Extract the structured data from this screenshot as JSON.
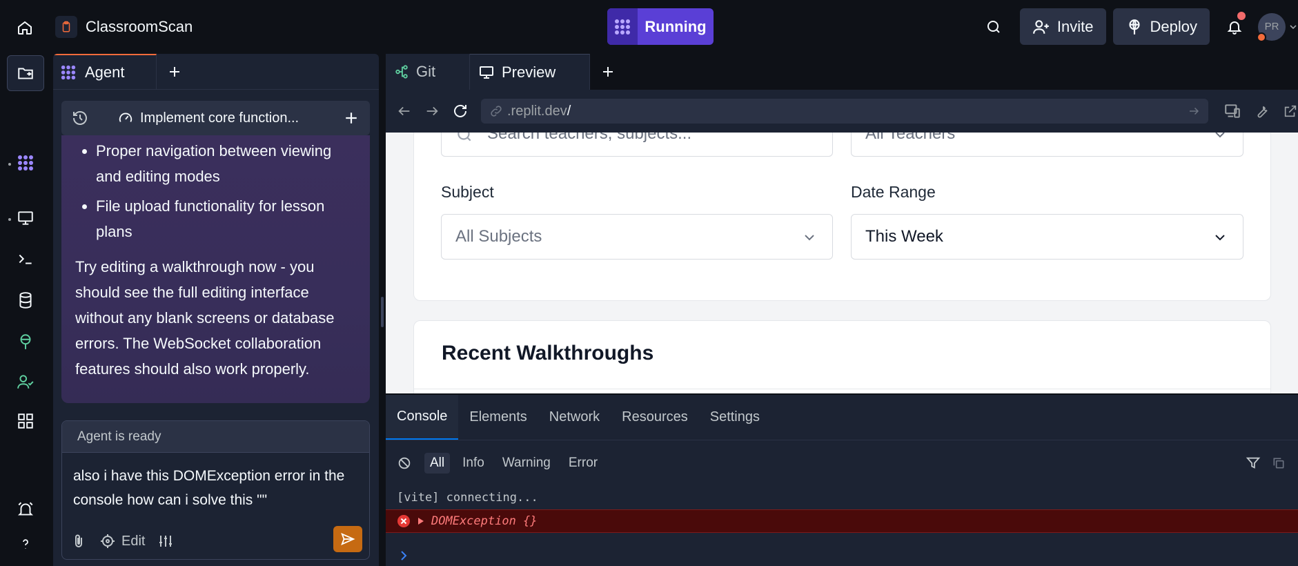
{
  "app": {
    "repl_name": "ClassroomScan",
    "run_label": "Running",
    "invite_label": "Invite",
    "deploy_label": "Deploy",
    "avatar_initials": "PR"
  },
  "agent": {
    "tab_label": "Agent",
    "task_title": "Implement core function...",
    "bullets": [
      "Proper navigation between viewing and editing modes",
      "File upload functionality for lesson plans"
    ],
    "paragraph": "Try editing a walkthrough now - you should see the full editing interface without any blank screens or database errors. The WebSocket collaboration features should also work properly.",
    "status": "Agent is ready",
    "input_text": "also i have this DOMException error in the console how can i solve this \"\"",
    "edit_label": "Edit"
  },
  "right_tabs": {
    "git": "Git",
    "preview": "Preview"
  },
  "url": {
    "domain": ".replit.dev",
    "path": "/"
  },
  "preview": {
    "search_placeholder": "Search teachers, subjects...",
    "teacher_value": "All Teachers",
    "subject_label": "Subject",
    "subject_value": "All Subjects",
    "date_label": "Date Range",
    "date_value": "This Week",
    "recent_heading": "Recent Walkthroughs"
  },
  "devtools": {
    "tabs": [
      "Console",
      "Elements",
      "Network",
      "Resources",
      "Settings"
    ],
    "filters": [
      "All",
      "Info",
      "Warning",
      "Error"
    ],
    "log_line": "[vite] connecting...",
    "error_line": "DOMException {}"
  },
  "colors": {
    "accent_run": "#5a3fd6",
    "send": "#c66a12",
    "error_bg": "#4a0a0a",
    "agent_msg_bg": "#3b2f5c"
  }
}
